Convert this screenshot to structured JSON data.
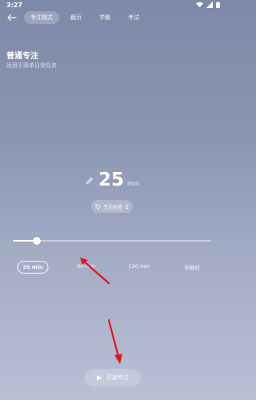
{
  "status": {
    "time": "3:27"
  },
  "nav": {
    "tabs": [
      {
        "label": "专注模式",
        "active": true
      },
      {
        "label": "翻页",
        "active": false
      },
      {
        "label": "学霸",
        "active": false
      },
      {
        "label": "考试",
        "active": false
      }
    ]
  },
  "mode": {
    "title": "普通专注",
    "subtitle": "适用于简单日常任务"
  },
  "timer": {
    "value": "25",
    "unit": "min"
  },
  "tag": {
    "label": "专注标签"
  },
  "slider": {
    "value_fraction": 0.12
  },
  "duration_options": [
    {
      "label": "25 min",
      "selected": true
    },
    {
      "label": "60 min",
      "selected": false
    },
    {
      "label": "120 min",
      "selected": false
    },
    {
      "label": "不限时",
      "selected": false
    }
  ],
  "start_button": {
    "label": "开始专注"
  },
  "colors": {
    "annotation_arrow": "#e5141c"
  }
}
